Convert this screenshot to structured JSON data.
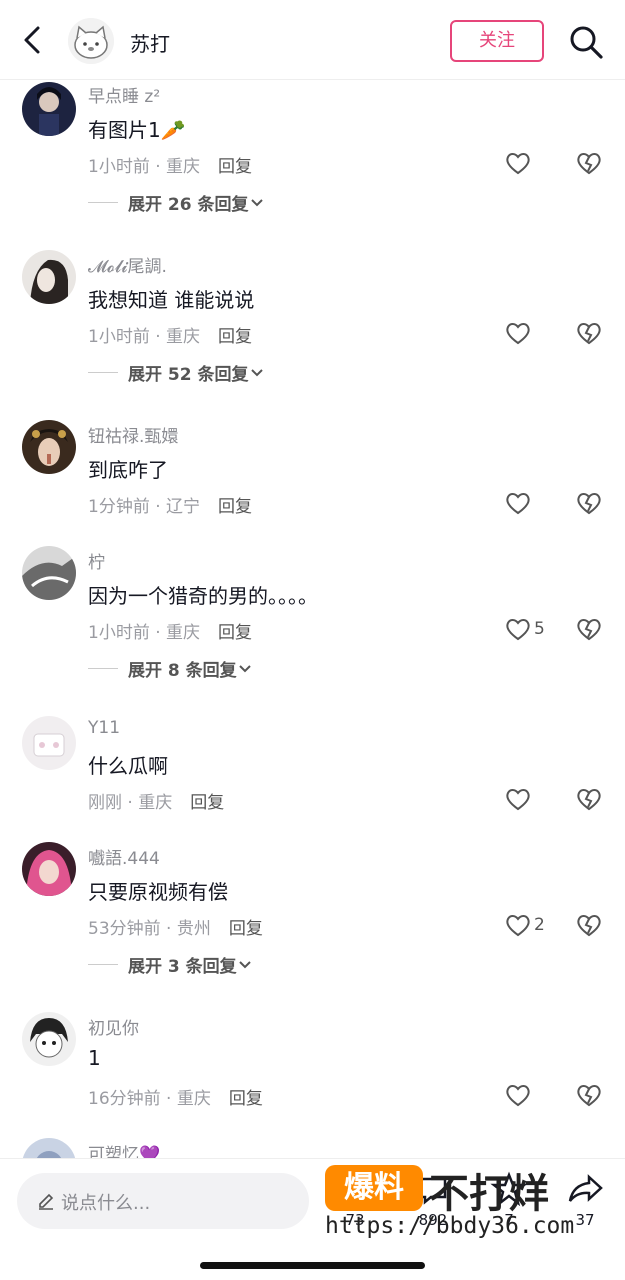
{
  "header": {
    "title": "苏打",
    "follow_label": "关注"
  },
  "comments": [
    {
      "user": "早点睡 z²",
      "text": "有图片1🥕",
      "time": "1小时前 · 重庆",
      "reply": "回复",
      "likes": "",
      "expand": "展开 26 条回复"
    },
    {
      "user": "𝓜𝓸𝓵𝓲尾調.",
      "text": "我想知道 谁能说说",
      "time": "1小时前 · 重庆",
      "reply": "回复",
      "likes": "",
      "expand": "展开 52 条回复"
    },
    {
      "user": "钮祜禄.甄嬛",
      "text": "到底咋了",
      "time": "1分钟前 · 辽宁",
      "reply": "回复",
      "likes": "",
      "expand": ""
    },
    {
      "user": "柠",
      "text": "因为一个猎奇的男的。。。。",
      "time": "1小时前 · 重庆",
      "reply": "回复",
      "likes": "5",
      "expand": "展开 8 条回复"
    },
    {
      "user": "Y11",
      "text": "什么瓜啊",
      "time": "刚刚 · 重庆",
      "reply": "回复",
      "likes": "",
      "expand": ""
    },
    {
      "user": "嚱語.444",
      "text": "只要原视频有偿",
      "time": "53分钟前 · 贵州",
      "reply": "回复",
      "likes": "2",
      "expand": "展开 3 条回复"
    },
    {
      "user": "初见你",
      "text": "1",
      "time": "16分钟前 · 重庆",
      "reply": "回复",
      "likes": "",
      "expand": ""
    },
    {
      "user": "可塑忆💜",
      "text": "",
      "time": "",
      "reply": "",
      "likes": "",
      "expand": ""
    }
  ],
  "bottom": {
    "placeholder": "说点什么...",
    "counts": [
      "73",
      "892",
      "7",
      "37"
    ]
  },
  "watermark": {
    "box": "爆料",
    "big": "不打烊",
    "url": "https://bbdy36.com"
  },
  "colors": {
    "accent": "#e6457a",
    "watermark_orange": "#ff8a00"
  }
}
